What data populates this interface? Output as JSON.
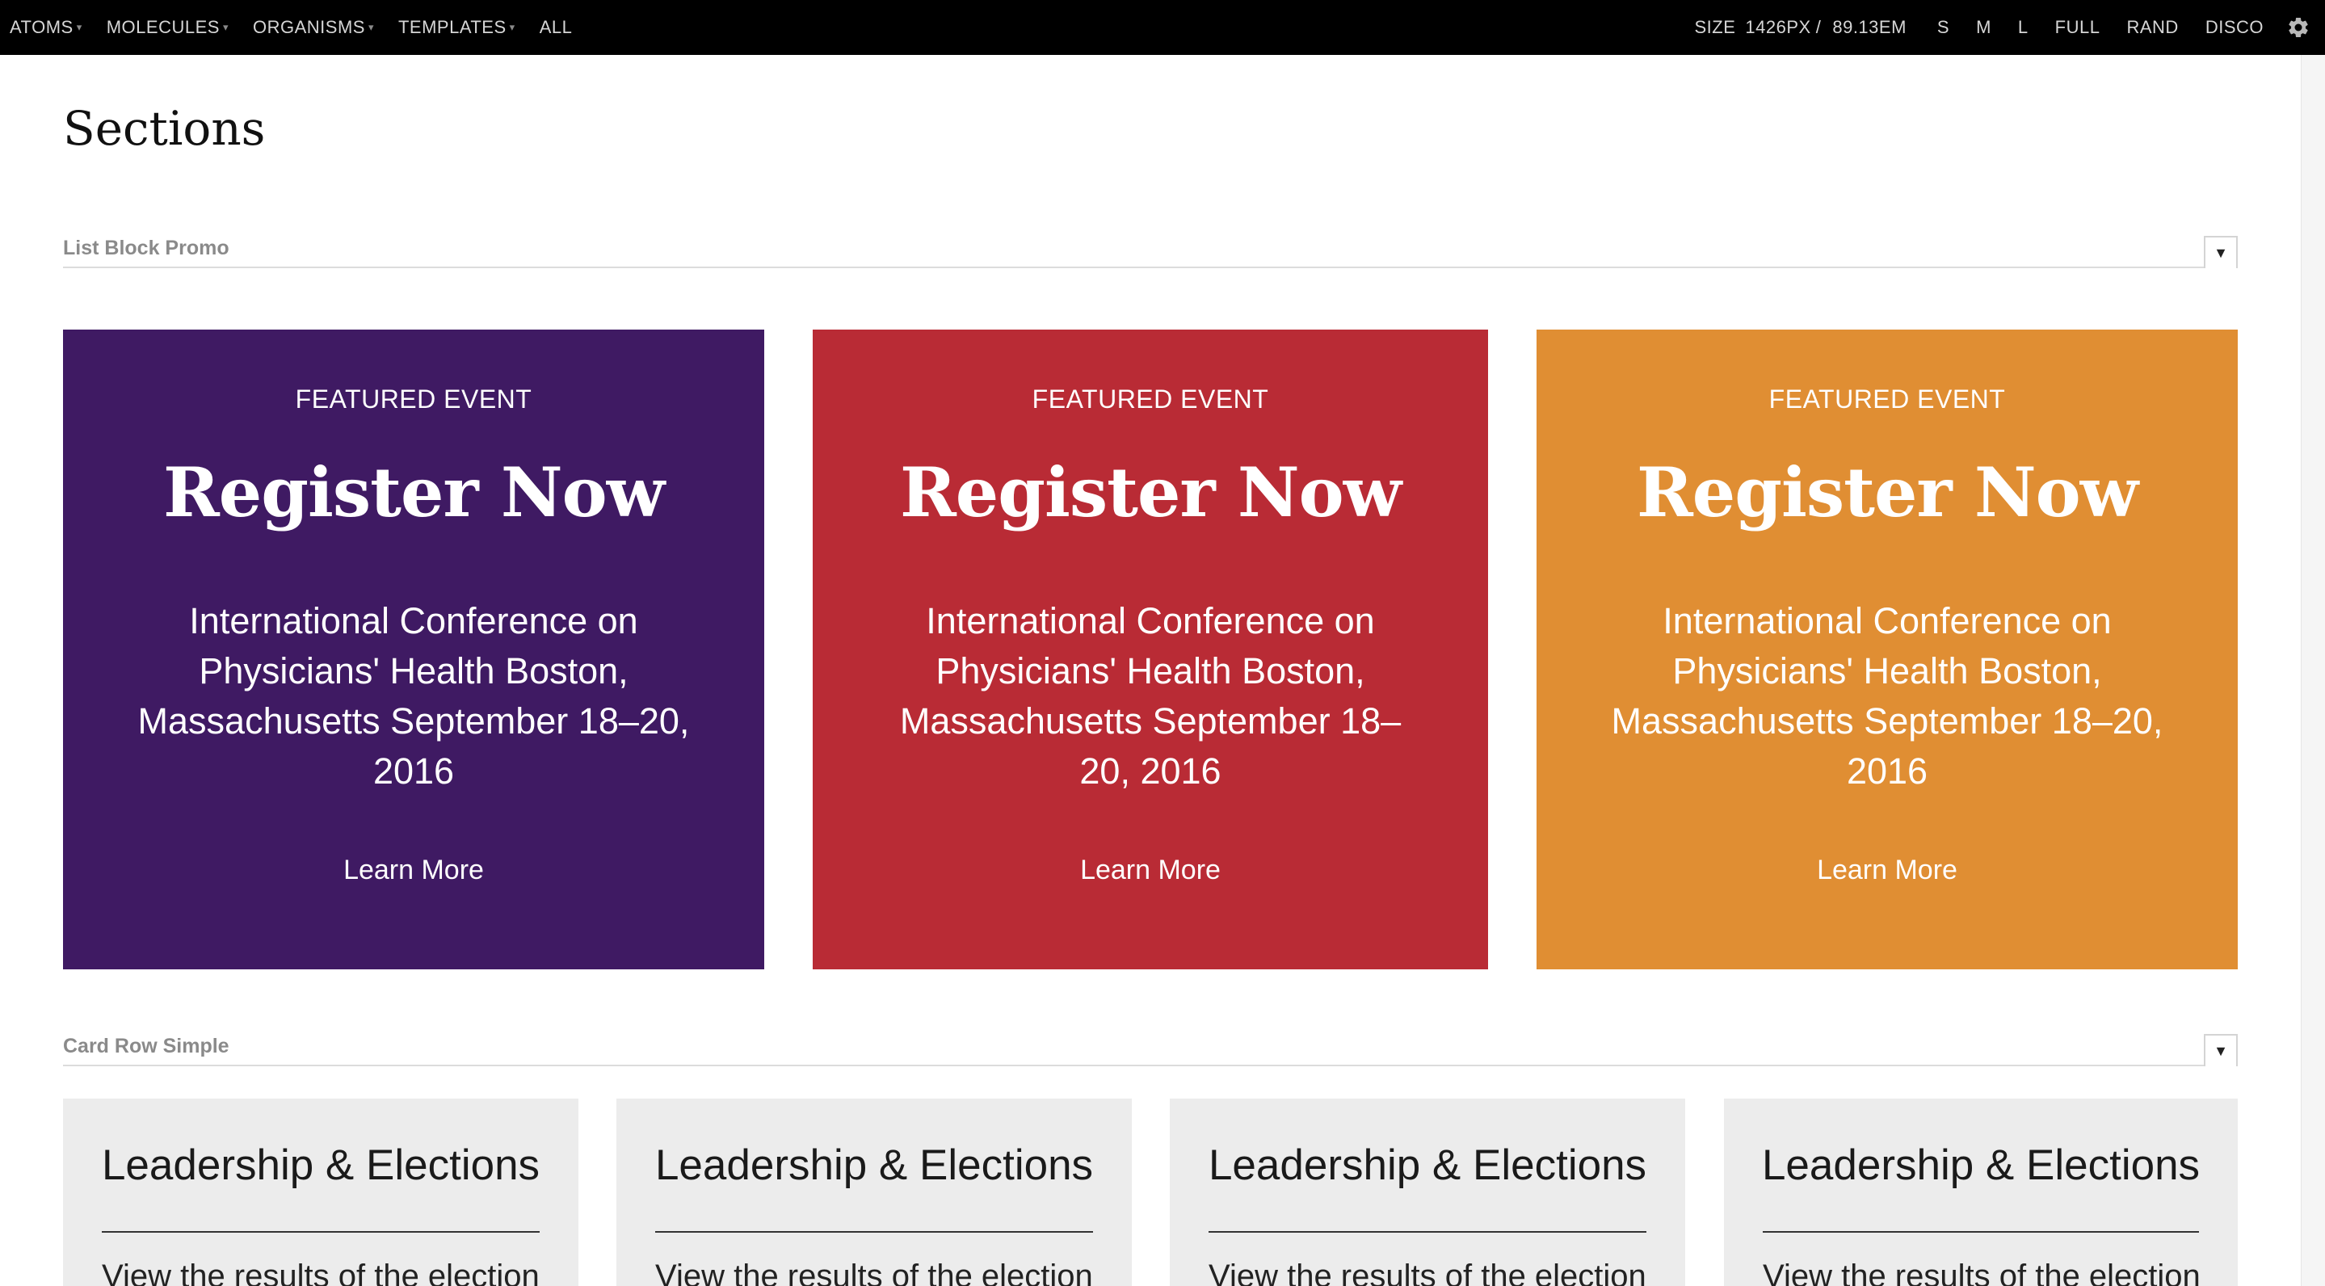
{
  "toolbar": {
    "nav": [
      {
        "label": "ATOMS",
        "has_dropdown": true
      },
      {
        "label": "MOLECULES",
        "has_dropdown": true
      },
      {
        "label": "ORGANISMS",
        "has_dropdown": true
      },
      {
        "label": "TEMPLATES",
        "has_dropdown": true
      },
      {
        "label": "ALL",
        "has_dropdown": false
      }
    ],
    "caret": "▾",
    "size_label": "SIZE",
    "size_px": "1426",
    "size_px_unit": "PX",
    "size_sep": "/",
    "size_em": "89.13EM",
    "viewport_buttons": [
      "S",
      "M",
      "L",
      "FULL",
      "RAND",
      "DISCO"
    ],
    "settings_icon": "gear-icon"
  },
  "page": {
    "title": "Sections"
  },
  "sections": [
    {
      "label": "List Block Promo",
      "toggle": "▼"
    },
    {
      "label": "Card Row Simple",
      "toggle": "▼"
    }
  ],
  "promos": [
    {
      "eyebrow": "FEATURED EVENT",
      "headline": "Register Now",
      "description": "International Conference on Physicians' Health Boston, Massachusetts September 18–20, 2016",
      "link": "Learn More",
      "color": "#3f1a63"
    },
    {
      "eyebrow": "FEATURED EVENT",
      "headline": "Register Now",
      "description": "International Conference on Physicians' Health Boston, Massachusetts September 18–20, 2016",
      "link": "Learn More",
      "color": "#b92b35"
    },
    {
      "eyebrow": "FEATURED EVENT",
      "headline": "Register Now",
      "description": "International Conference on Physicians' Health Boston, Massachusetts September 18–20, 2016",
      "link": "Learn More",
      "color": "#e08e33"
    }
  ],
  "cards": [
    {
      "title": "Leadership & Elections",
      "text": "View the results of the election"
    },
    {
      "title": "Leadership & Elections",
      "text": "View the results of the election"
    },
    {
      "title": "Leadership & Elections",
      "text": "View the results of the election"
    },
    {
      "title": "Leadership & Elections",
      "text": "View the results of the election"
    }
  ],
  "colors": {
    "toolbar_bg": "#000000",
    "toolbar_text": "#d6d6d6",
    "section_label": "#8a8a8a",
    "card_bg": "#ececec"
  }
}
